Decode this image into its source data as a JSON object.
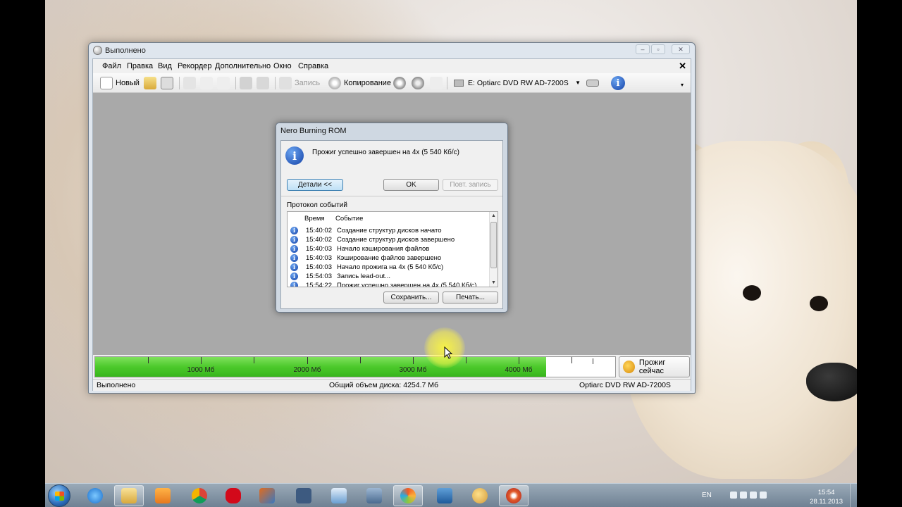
{
  "window": {
    "title": "Выполнено"
  },
  "menu": [
    "Файл",
    "Правка",
    "Вид",
    "Рекордер",
    "Дополнительно",
    "Окно",
    "Справка"
  ],
  "toolbar": {
    "new_label": "Новый",
    "burn_label": "Запись",
    "copy_label": "Копирование",
    "drive_label": "E: Optiarc DVD RW AD-7200S"
  },
  "capacity": {
    "ticks": [
      "1000 Мб",
      "2000 Мб",
      "3000 Мб",
      "4000 Мб"
    ],
    "used_mb": 4254.7,
    "burn_now_label": "Прожиг сейчас"
  },
  "status": {
    "left": "Выполнено",
    "center": "Общий объем диска: 4254.7 Мб",
    "right": "Optiarc  DVD RW AD-7200S"
  },
  "dialog": {
    "title": "Nero Burning ROM",
    "message": "Прожиг успешно завершен на 4x (5 540 Кб/с)",
    "details_button": "Детали <<",
    "ok_button": "OK",
    "reburn_button": "Повт. запись",
    "log_title": "Протокол событий",
    "col_time": "Время",
    "col_event": "Событие",
    "rows": [
      {
        "time": "15:40:02",
        "event": "Создание структур дисков начато"
      },
      {
        "time": "15:40:02",
        "event": "Создание структур дисков завершено"
      },
      {
        "time": "15:40:03",
        "event": "Начало кэширования файлов"
      },
      {
        "time": "15:40:03",
        "event": "Кэширование файлов завершено"
      },
      {
        "time": "15:40:03",
        "event": "Начало прожига на 4x (5 540 Кб/с)"
      },
      {
        "time": "15:54:03",
        "event": "Запись lead-out..."
      },
      {
        "time": "15:54:22",
        "event": "Прожиг успешно завершен на 4x (5 540 Кб/с)"
      }
    ],
    "save_button": "Сохранить...",
    "print_button": "Печать..."
  },
  "taskbar": {
    "lang": "EN",
    "time": "15:54",
    "date": "28.11.2013"
  },
  "colors": {
    "capacity_fill": "#4cc92b",
    "workarea": "#a9a9a9",
    "highlight": "#fff43c"
  }
}
